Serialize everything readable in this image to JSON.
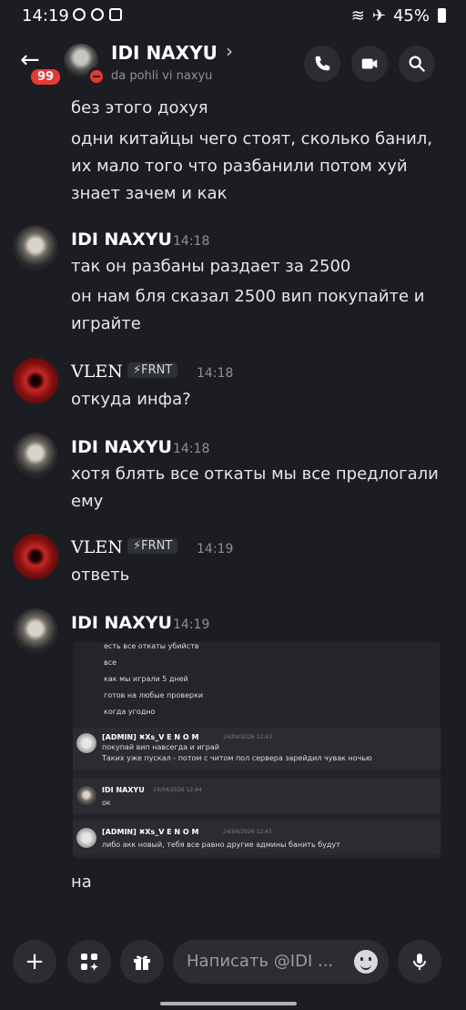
{
  "status_bar": {
    "time": "14:19",
    "battery": "45%"
  },
  "header": {
    "title": "IDI NAXYU",
    "subtitle": "da pohli vi naxyu",
    "unread_badge": "99",
    "chevron": "›"
  },
  "continued_lines": [
    "без этого дохуя",
    "одни китайцы чего стоят, сколько банил,",
    "их мало того что разбанили потом хуй",
    "знает зачем и как"
  ],
  "messages": [
    {
      "author": "IDI NAXYU",
      "time": "14:18",
      "lines": [
        "так он разбаны раздает за 2500",
        "он нам бля сказал 2500 вип покупайте и",
        "играйте"
      ]
    },
    {
      "author": "VLEN",
      "tag": "⚡FRNT",
      "time": "14:18",
      "lines": [
        "откуда инфа?"
      ]
    },
    {
      "author": "IDI NAXYU",
      "time": "14:18",
      "lines": [
        "хотя блять все откаты мы все предлогали",
        "ему"
      ]
    },
    {
      "author": "VLEN",
      "tag": "⚡FRNT",
      "time": "14:19",
      "lines": [
        "ответь"
      ]
    },
    {
      "author": "IDI NAXYU",
      "time": "14:19",
      "lines": []
    }
  ],
  "embed": {
    "top_lines": [
      "есть все откаты убийств",
      "все",
      "как мы играли 5 дней",
      "готов на любые проверки",
      "когда угодно"
    ],
    "replies": [
      {
        "author": "[ADMIN] ✖Xs_V E N O M",
        "time": "24/04/2026 12:43",
        "lines": [
          "покупай вип навсегда и играй",
          "Таких уже пускал - потом с читом пол сервера зарейдил чувак ночью"
        ]
      },
      {
        "author": "IDI NAXYU",
        "time": "24/04/2026 12:44",
        "lines": [
          "ок"
        ]
      },
      {
        "author": "[ADMIN] ✖Xs_V E N O M",
        "time": "24/04/2026 12:45",
        "lines": [
          "либо акк новый, тебя все равно другие админы банить будут"
        ]
      }
    ]
  },
  "last_line": "на",
  "composer": {
    "placeholder": "Написать @IDI ..."
  }
}
